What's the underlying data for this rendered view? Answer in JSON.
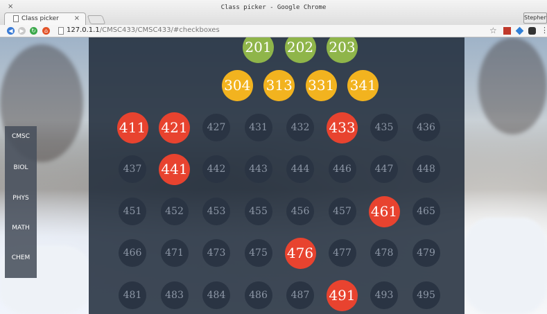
{
  "browser": {
    "window_title": "Class picker - Google Chrome",
    "tab_title": "Class picker",
    "tab_close": "×",
    "window_close": "×",
    "url_host": "127.0.1.1",
    "url_path": "/CMSC433/CMSC433/#checkboxes",
    "user_chip": "Stephen",
    "star": "☆"
  },
  "sidebar": {
    "items": [
      {
        "label": "CMSC"
      },
      {
        "label": "BIOL"
      },
      {
        "label": "PHYS"
      },
      {
        "label": "MATH"
      },
      {
        "label": "CHEM"
      }
    ]
  },
  "courses": {
    "rows": [
      [
        {
          "label": "201",
          "status": "selected",
          "color": "green"
        },
        {
          "label": "202",
          "status": "selected",
          "color": "green"
        },
        {
          "label": "203",
          "status": "selected",
          "color": "green"
        }
      ],
      [
        {
          "label": "304",
          "status": "selected",
          "color": "yellow"
        },
        {
          "label": "313",
          "status": "selected",
          "color": "yellow"
        },
        {
          "label": "331",
          "status": "selected",
          "color": "yellow"
        },
        {
          "label": "341",
          "status": "selected",
          "color": "yellow"
        }
      ],
      [
        {
          "label": "411",
          "status": "selected",
          "color": "red"
        },
        {
          "label": "421",
          "status": "selected",
          "color": "red"
        },
        {
          "label": "427",
          "status": "unselected"
        },
        {
          "label": "431",
          "status": "unselected"
        },
        {
          "label": "432",
          "status": "unselected"
        },
        {
          "label": "433",
          "status": "selected",
          "color": "red"
        },
        {
          "label": "435",
          "status": "unselected"
        },
        {
          "label": "436",
          "status": "unselected"
        }
      ],
      [
        {
          "label": "437",
          "status": "unselected"
        },
        {
          "label": "441",
          "status": "selected",
          "color": "red"
        },
        {
          "label": "442",
          "status": "unselected"
        },
        {
          "label": "443",
          "status": "unselected"
        },
        {
          "label": "444",
          "status": "unselected"
        },
        {
          "label": "446",
          "status": "unselected"
        },
        {
          "label": "447",
          "status": "unselected"
        },
        {
          "label": "448",
          "status": "unselected"
        }
      ],
      [
        {
          "label": "451",
          "status": "unselected"
        },
        {
          "label": "452",
          "status": "unselected"
        },
        {
          "label": "453",
          "status": "unselected"
        },
        {
          "label": "455",
          "status": "unselected"
        },
        {
          "label": "456",
          "status": "unselected"
        },
        {
          "label": "457",
          "status": "unselected"
        },
        {
          "label": "461",
          "status": "selected",
          "color": "red"
        },
        {
          "label": "465",
          "status": "unselected"
        }
      ],
      [
        {
          "label": "466",
          "status": "unselected"
        },
        {
          "label": "471",
          "status": "unselected"
        },
        {
          "label": "473",
          "status": "unselected"
        },
        {
          "label": "475",
          "status": "unselected"
        },
        {
          "label": "476",
          "status": "selected",
          "color": "red"
        },
        {
          "label": "477",
          "status": "unselected"
        },
        {
          "label": "478",
          "status": "unselected"
        },
        {
          "label": "479",
          "status": "unselected"
        }
      ],
      [
        {
          "label": "481",
          "status": "unselected"
        },
        {
          "label": "483",
          "status": "unselected"
        },
        {
          "label": "484",
          "status": "unselected"
        },
        {
          "label": "486",
          "status": "unselected"
        },
        {
          "label": "487",
          "status": "unselected"
        },
        {
          "label": "491",
          "status": "selected",
          "color": "red"
        },
        {
          "label": "493",
          "status": "unselected"
        },
        {
          "label": "495",
          "status": "unselected"
        }
      ]
    ]
  },
  "colors": {
    "red": "#e8432f",
    "yellow": "#f2b31f",
    "green": "#8fb54a",
    "unselected_bg": "#2a3443",
    "unselected_text": "#8d97a6",
    "panel": "#1f2b3a"
  }
}
